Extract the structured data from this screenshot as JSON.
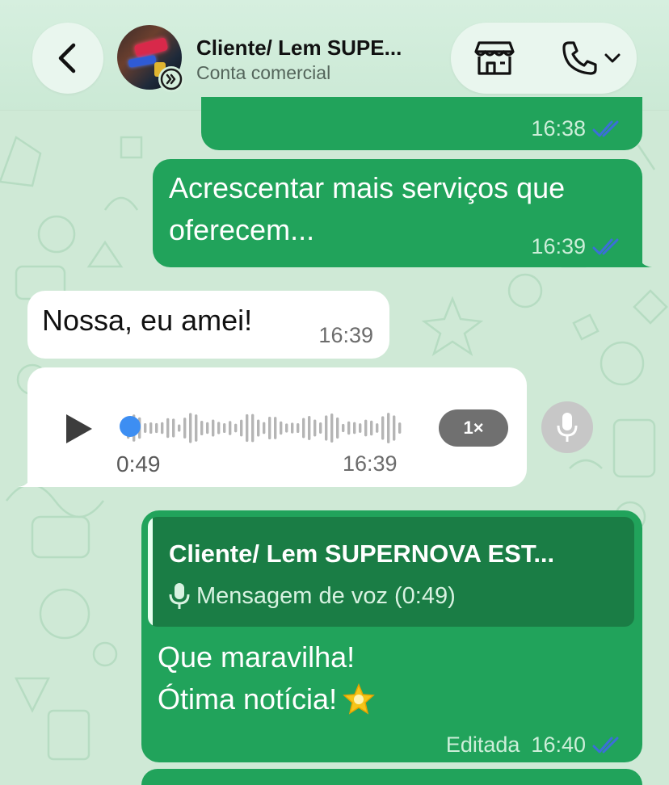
{
  "header": {
    "contact_name": "Cliente/ Lem SUPE...",
    "contact_subtitle": "Conta comercial",
    "back_icon": "chevron-left-icon",
    "store_icon": "store-icon",
    "call_icon": "phone-icon",
    "call_menu_icon": "chevron-down-icon"
  },
  "messages": [
    {
      "direction": "out",
      "time": "16:38",
      "status": "read"
    },
    {
      "direction": "out",
      "text_lines": [
        "Acrescentar mais serviços que",
        "oferecem..."
      ],
      "time": "16:39",
      "status": "read"
    },
    {
      "direction": "in",
      "text": "Nossa, eu amei!",
      "time": "16:39"
    },
    {
      "direction": "in",
      "type": "voice",
      "duration": "0:49",
      "time": "16:39",
      "speed": "1×",
      "progress": 0
    },
    {
      "direction": "out",
      "quote": {
        "author": "Cliente/ Lem SUPERNOVA EST...",
        "preview": "Mensagem de voz (0:49)"
      },
      "text_lines": [
        "Que maravilha!",
        "Ótima notícia!"
      ],
      "emoji": "🌟",
      "edited_label": "Editada",
      "time": "16:40",
      "status": "read"
    }
  ],
  "colors": {
    "outgoing_bubble": "#21a35b",
    "incoming_bubble": "#ffffff",
    "read_ticks": "#3b6fd8",
    "background": "#cfe9d6"
  }
}
